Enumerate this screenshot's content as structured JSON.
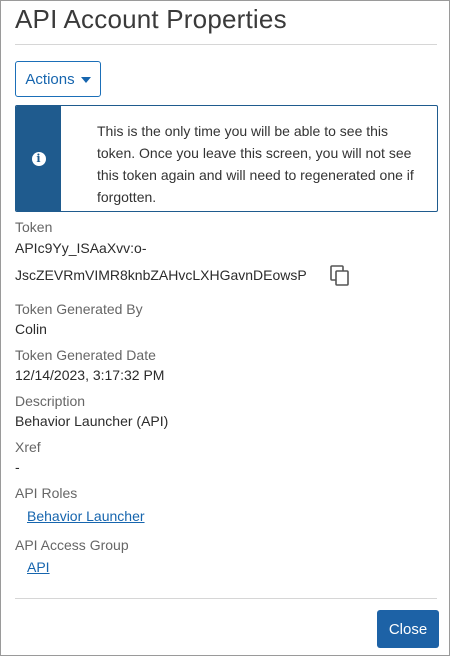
{
  "dialog": {
    "title": "API Account Properties"
  },
  "toolbar": {
    "actions_label": "Actions"
  },
  "notice": {
    "icon": "info-icon",
    "text": "This is the only time you will be able to see this token. Once you leave this screen, you will not see this token again and will need to regenerated one if forgotten."
  },
  "fields": {
    "token": {
      "label": "Token",
      "value_line1": "APIc9Yy_ISAaXvv:o-",
      "value_line2": "JscZEVRmVIMR8knbZAHvcLXHGavnDEowsP"
    },
    "generated_by": {
      "label": "Token Generated By",
      "value": "Colin"
    },
    "generated_date": {
      "label": "Token Generated Date",
      "value": "12/14/2023, 3:17:32 PM"
    },
    "description": {
      "label": "Description",
      "value": "Behavior Launcher (API)"
    },
    "xref": {
      "label": "Xref",
      "value": "-"
    },
    "api_roles": {
      "label": "API Roles",
      "link": "Behavior Launcher"
    },
    "api_access_group": {
      "label": "API Access Group",
      "link": "API"
    }
  },
  "footer": {
    "close_label": "Close"
  },
  "colors": {
    "primary": "#1d62a6",
    "link": "#1665ae",
    "notice_strip": "#1f5b8e"
  }
}
